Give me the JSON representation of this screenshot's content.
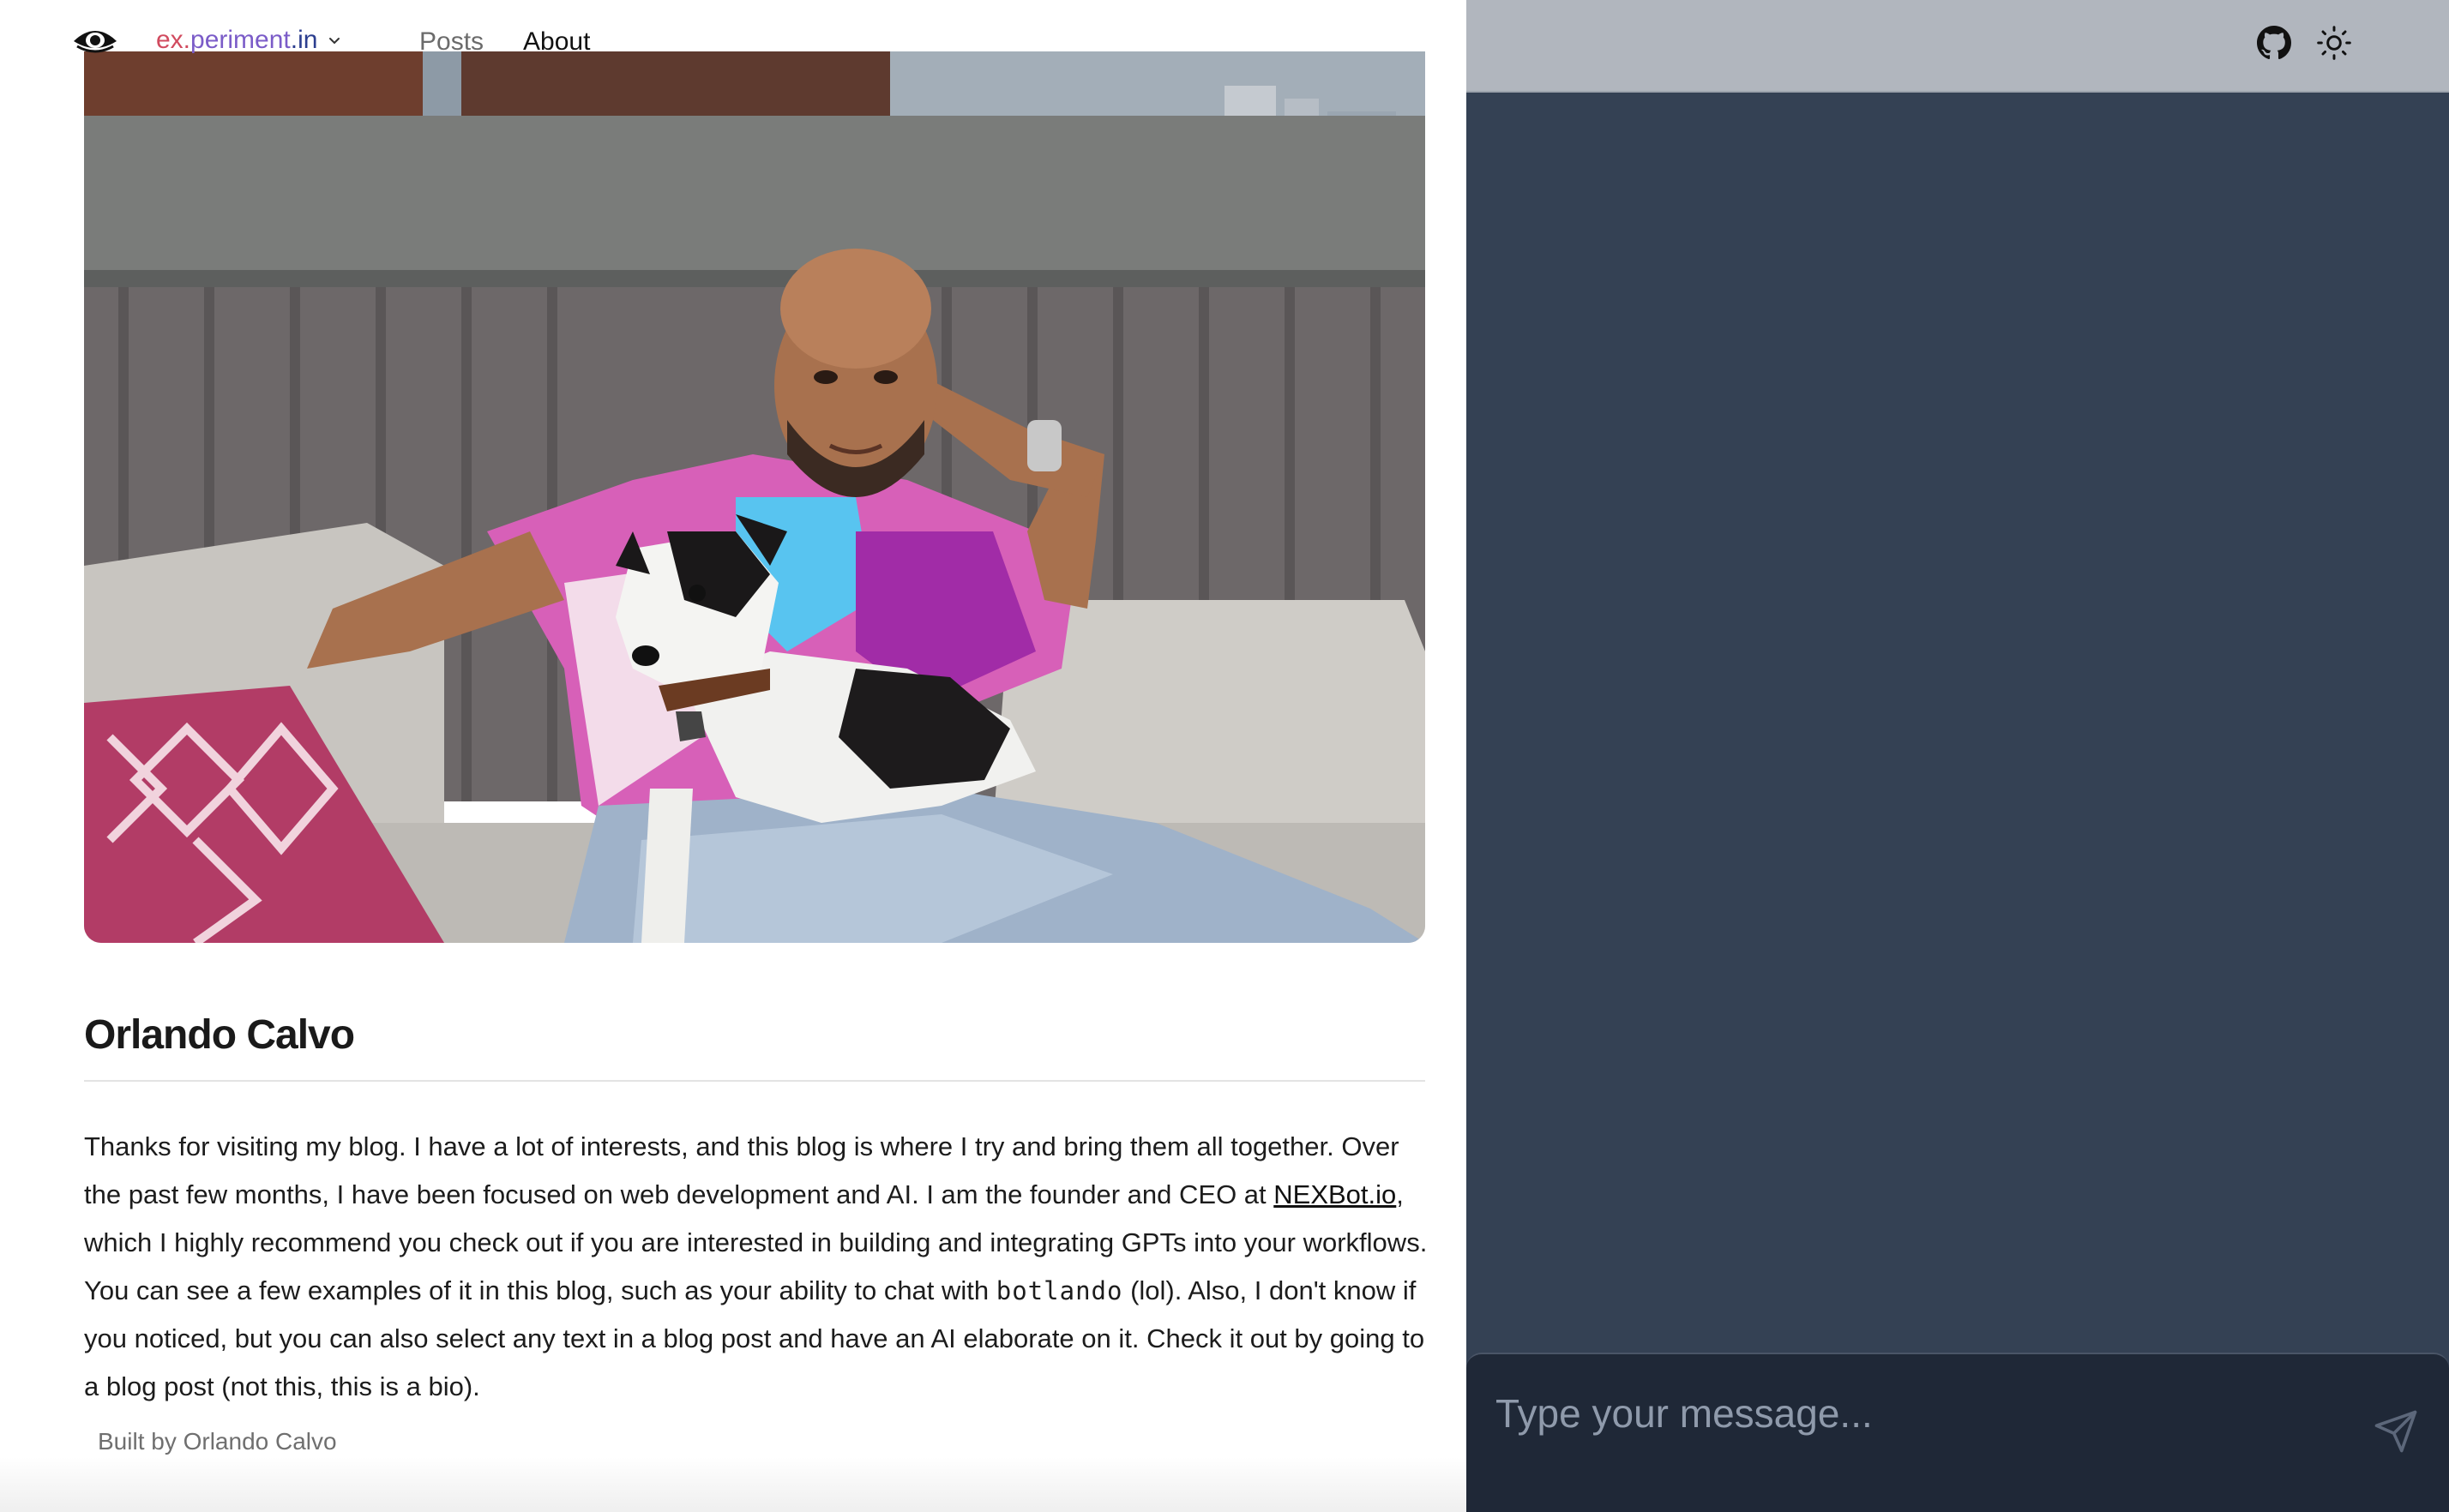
{
  "header": {
    "brand": {
      "part1": "ex.",
      "part2": "periment",
      "part3": ".in"
    },
    "nav": {
      "posts": "Posts",
      "about": "About"
    },
    "icons": {
      "logo": "eye-logo-icon",
      "dropdown": "chevron-down-icon",
      "github": "github-icon",
      "theme": "sun-icon"
    }
  },
  "main": {
    "title": "Orlando Calvo",
    "bio": {
      "part1": "Thanks for visiting my blog. I have a lot of interests, and this blog is where I try and bring them all together. Over the past few months, I have been focused on web development and AI. I am the founder and CEO at ",
      "link": "NEXBot.io",
      "part2": ", which I highly recommend you check out if you are interested in building and integrating GPTs into your workflows. You can see a few examples of it in this blog, such as your ability to chat with ",
      "code": "botlando",
      "part3": " (lol). Also, I don't know if you noticed, but you can also select any text in a blog post and have an AI elaborate on it. Check it out by going to a blog post (not this, this is a bio)."
    },
    "footer": "Built by Orlando Calvo"
  },
  "chat": {
    "placeholder": "Type your message...",
    "send_icon": "send-icon"
  },
  "colors": {
    "chat_panel": "#344154",
    "chat_input": "#1f2837",
    "brand_ex": "#d14b5f",
    "brand_periment": "#7b5cc8",
    "brand_in": "#2c3e8f"
  }
}
